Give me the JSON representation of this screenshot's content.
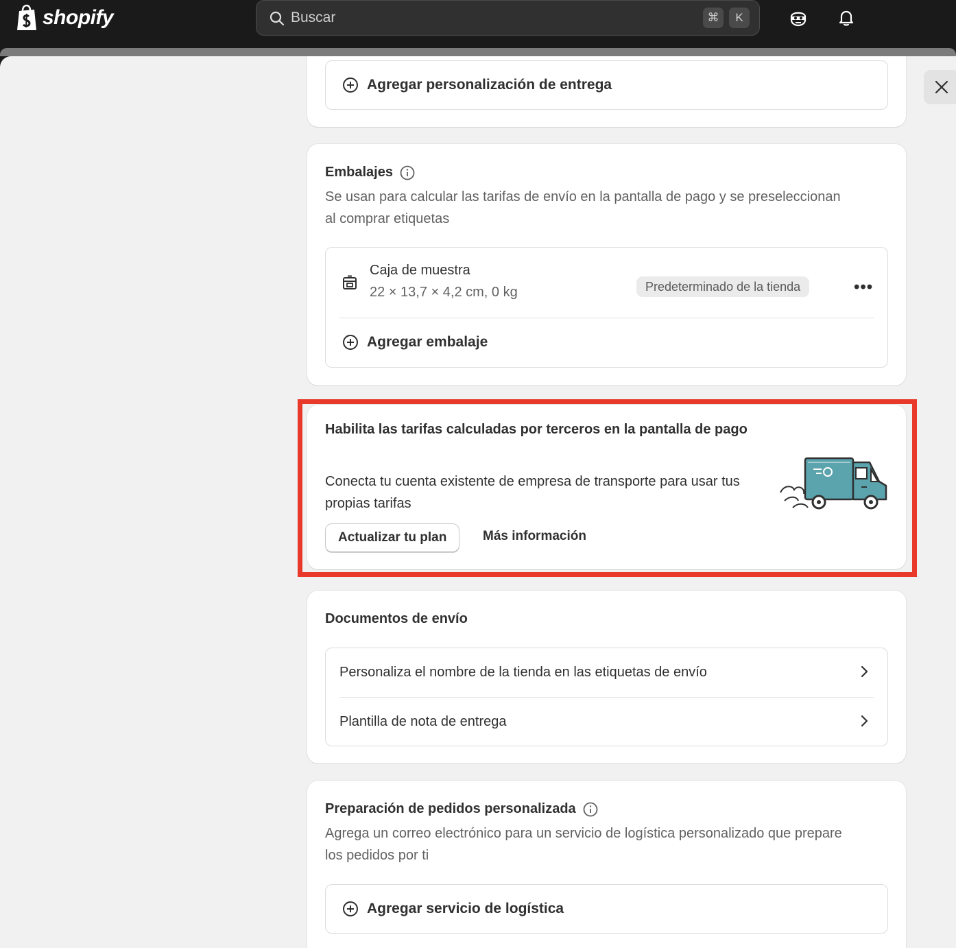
{
  "topbar": {
    "brand": "shopify",
    "search_placeholder": "Buscar",
    "shortcut_cmd": "⌘",
    "shortcut_key": "K"
  },
  "delivery_customization": {
    "add_label": "Agregar personalización de entrega"
  },
  "packages": {
    "title": "Embalajes",
    "description": "Se usan para calcular las tarifas de envío en la pantalla de pago y se preseleccionan al comprar etiquetas",
    "items": [
      {
        "name": "Caja de muestra",
        "dimensions": "22 × 13,7 × 4,2 cm, 0 kg",
        "badge": "Predeterminado de la tienda"
      }
    ],
    "add_label": "Agregar embalaje"
  },
  "carrier_promo": {
    "title": "Habilita las tarifas calculadas por terceros en la pantalla de pago",
    "description": "Conecta tu cuenta existente de empresa de transporte para usar tus propias tarifas",
    "primary_button": "Actualizar tu plan",
    "secondary_button": "Más información",
    "highlight_color": "#e8392a"
  },
  "shipping_docs": {
    "title": "Documentos de envío",
    "items": [
      {
        "label": "Personaliza el nombre de la tienda en las etiquetas de envío"
      },
      {
        "label": "Plantilla de nota de entrega"
      }
    ]
  },
  "custom_fulfillment": {
    "title": "Preparación de pedidos personalizada",
    "description": "Agrega un correo electrónico para un servicio de logística personalizado que prepare los pedidos por ti",
    "add_label": "Agregar servicio de logística"
  },
  "colors": {
    "topbar": "#1a1a1a",
    "page_bg": "#f1f1f1",
    "card_bg": "#ffffff",
    "truck": "#5ba3ad"
  }
}
